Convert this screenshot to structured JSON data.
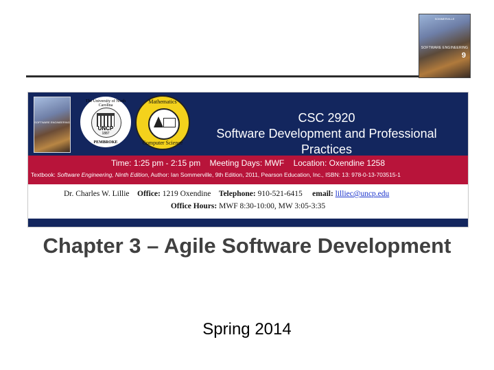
{
  "header_book": {
    "small_text": "SOMMERVILLE",
    "title": "SOFTWARE ENGINEERING",
    "edition": "9"
  },
  "banner": {
    "book_title": "SOFTWARE ENGINEERING",
    "seal": {
      "ring_top": "The University of North Carolina",
      "name": "UNCP",
      "year": "1887",
      "ring_bottom": "PEMBROKE"
    },
    "math_logo": {
      "top": "Mathematics",
      "bottom": "Computer Science"
    },
    "course_code": "CSC 2920",
    "course_name": "Software Development and Professional Practices",
    "schedule": "Time: 1:25 pm - 2:15 pm    Meeting Days: MWF    Location: Oxendine 1258",
    "textbook_prefix": "Textbook: ",
    "textbook_title": "Software Engineering, Ninth Edition",
    "textbook_rest": ", Author: Ian Sommerville, 9th Edition, 2011, Pearson Education, Inc., ISBN: 13: 978-0-13-703515-1",
    "instructor": "Dr. Charles W. Lillie",
    "office_label": "Office:",
    "office": "1219 Oxendine",
    "telephone_label": "Telephone:",
    "telephone": "910-521-6415",
    "email_label": "email:",
    "email": "lilliec@uncp.edu",
    "hours_label": "Office Hours:",
    "hours": "MWF 8:30-10:00, MW 3:05-3:35"
  },
  "slide": {
    "title": "Chapter 3 – Agile Software Development",
    "subtitle": "Spring 2014"
  }
}
